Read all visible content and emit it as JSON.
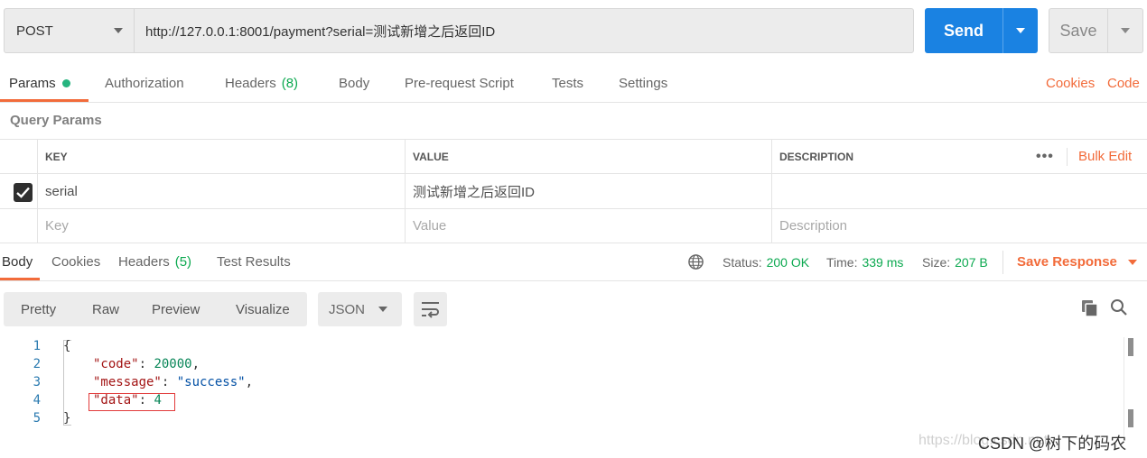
{
  "request": {
    "method": "POST",
    "url": "http://127.0.0.1:8001/payment?serial=测试新增之后返回ID",
    "send_label": "Send",
    "save_label": "Save"
  },
  "request_tabs": {
    "params": "Params",
    "authorization": "Authorization",
    "headers": "Headers",
    "headers_count": "(8)",
    "body": "Body",
    "prerequest": "Pre-request Script",
    "tests": "Tests",
    "settings": "Settings",
    "cookies_link": "Cookies",
    "code_link": "Code"
  },
  "query_params": {
    "title": "Query Params",
    "headers": {
      "key": "KEY",
      "value": "VALUE",
      "description": "DESCRIPTION"
    },
    "bulk_edit": "Bulk Edit",
    "more": "•••",
    "rows": [
      {
        "checked": true,
        "key": "serial",
        "value": "测试新增之后返回ID",
        "description": ""
      }
    ],
    "placeholders": {
      "key": "Key",
      "value": "Value",
      "description": "Description"
    }
  },
  "response_tabs": {
    "body": "Body",
    "cookies": "Cookies",
    "headers": "Headers",
    "headers_count": "(5)",
    "test_results": "Test Results",
    "status_label": "Status:",
    "status_value": "200 OK",
    "time_label": "Time:",
    "time_value": "339 ms",
    "size_label": "Size:",
    "size_value": "207 B",
    "save_response": "Save Response"
  },
  "view": {
    "pretty": "Pretty",
    "raw": "Raw",
    "preview": "Preview",
    "visualize": "Visualize",
    "format": "JSON"
  },
  "code": {
    "line_numbers": [
      "1",
      "2",
      "3",
      "4",
      "5"
    ],
    "open_brace": "{",
    "close_brace": "}",
    "code_key": "\"code\"",
    "code_value": "20000",
    "message_key": "\"message\"",
    "message_value": "\"success\"",
    "data_key": "\"data\"",
    "data_value": "4",
    "colon": ": ",
    "comma": ","
  },
  "watermark": {
    "faint": "https://blog.csdn.net",
    "brand": "CSDN @树下的码农"
  },
  "colors": {
    "accent": "#f26b3a",
    "send": "#1a82e2",
    "success": "#0ca950"
  }
}
